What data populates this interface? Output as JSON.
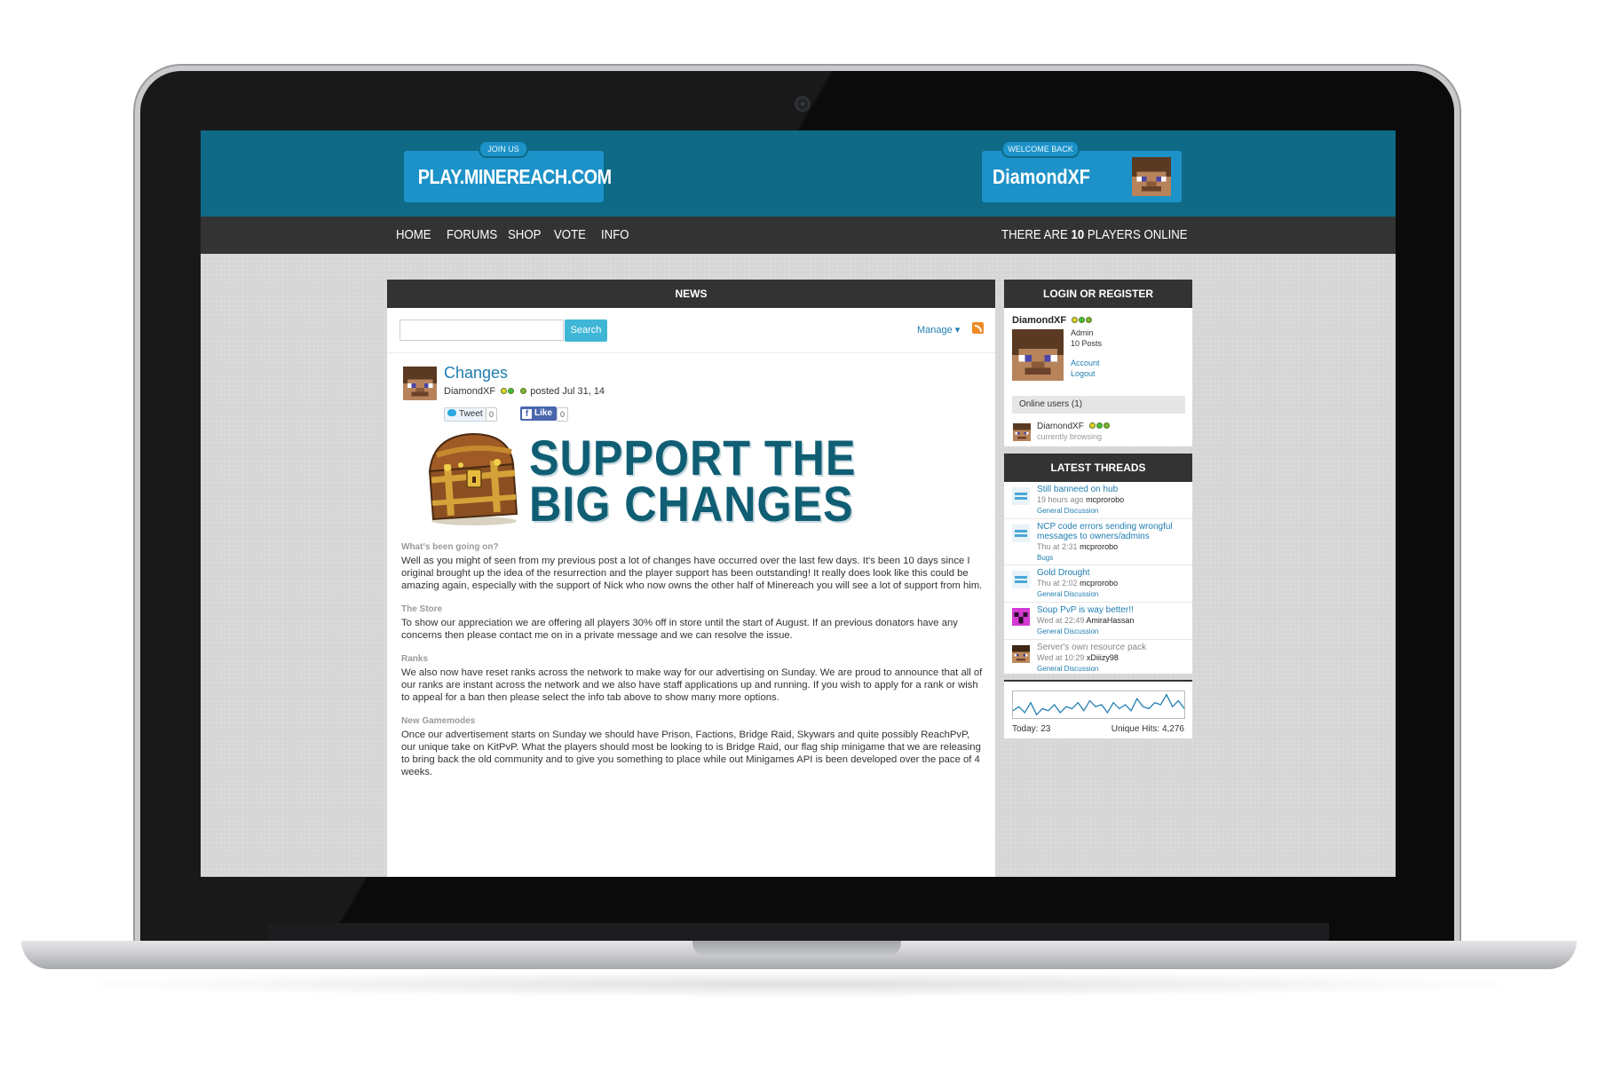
{
  "header": {
    "join_tag": "JOIN US",
    "server_address": "PLAY.MINEREACH.COM",
    "welcome_tag": "WELCOME BACK",
    "username": "DiamondXF"
  },
  "nav": {
    "items": [
      "HOME",
      "FORUMS",
      "SHOP",
      "VOTE",
      "INFO"
    ],
    "players_prefix": "THERE ARE",
    "players_count": "10",
    "players_suffix": "PLAYERS ONLINE"
  },
  "news": {
    "title": "NEWS",
    "search_placeholder": "",
    "search_button": "Search",
    "manage_label": "Manage ▾",
    "post": {
      "title": "Changes",
      "author": "DiamondXF",
      "posted": "posted Jul 31, 14",
      "tweet_label": "Tweet",
      "tweet_count": "0",
      "like_label": "Like",
      "like_count": "0",
      "banner_line1": "SUPPORT THE",
      "banner_line2": "BIG CHANGES",
      "sections": [
        {
          "heading": "What's been going on?",
          "body": "Well as you might of seen from my previous post a lot of changes have occurred over the last few days. It's been 10 days since I original brought up the idea of the resurrection and the player support has been outstanding! It really does look like this could be amazing again, especially with the support of Nick who now owns the other half of Minereach you will see a lot of support from him."
        },
        {
          "heading": "The Store",
          "body": "To show our appreciation we are offering all players 30% off in store until the start of August. If an previous donators have any concerns then please contact me on in a private message and we can resolve the issue."
        },
        {
          "heading": "Ranks",
          "body": "We also now have reset ranks across the network to make way for our advertising on Sunday. We are proud to announce that all of our ranks are instant across the network and we also have staff applications up and running. If you wish to apply for a rank or wish to appeal for a ban then please select the info tab above to show many more options."
        },
        {
          "heading": "New Gamemodes",
          "body": "Once our advertisement starts on Sunday we should have Prison, Factions, Bridge Raid, Skywars and quite possibly ReachPvP, our unique take on KitPvP. What the players should most be looking to is Bridge Raid, our flag ship minigame that we are releasing to bring back the old community and to give you something to place while out Minigames API is been developed over the pace of 4 weeks."
        }
      ]
    }
  },
  "sidebar": {
    "login_title": "LOGIN OR REGISTER",
    "user": {
      "name": "DiamondXF",
      "role": "Admin",
      "posts": "10 Posts",
      "account": "Account",
      "logout": "Logout"
    },
    "online_label": "Online users (1)",
    "online_user": {
      "name": "DiamondXF",
      "status": "currently browsing"
    },
    "threads_title": "LATEST THREADS",
    "threads": [
      {
        "title": "Still banneed on hub",
        "time": "19 hours ago",
        "user": "mcprorobo",
        "category": "General Discussion",
        "icon": "minereach-icon"
      },
      {
        "title": "NCP code errors sending wrongful messages to owners/admins",
        "time": "Thu at 2:31",
        "user": "mcprorobo",
        "category": "Bugs",
        "icon": "minereach-icon"
      },
      {
        "title": "Gold Drought",
        "time": "Thu at 2:02",
        "user": "mcprorobo",
        "category": "General Discussion",
        "icon": "minereach-icon"
      },
      {
        "title": "Soup PvP is way better!!",
        "time": "Wed at 22:49",
        "user": "AmiraHassan",
        "category": "General Discussion",
        "icon": "creeper-icon"
      },
      {
        "title": "Server's own resource pack",
        "time": "Wed at 10:29",
        "user": "xDiiizy98",
        "category": "General Discussion",
        "icon": "steve-icon"
      }
    ],
    "stats": {
      "today": "Today: 23",
      "unique": "Unique Hits: 4,276",
      "sparkline": [
        10,
        12,
        9,
        14,
        8,
        11,
        10,
        13,
        9,
        12,
        11,
        14,
        10,
        15,
        12,
        13,
        9,
        14,
        11,
        13,
        10,
        16,
        12,
        11,
        14,
        13,
        18,
        12,
        15,
        11
      ]
    }
  },
  "colors": {
    "header_bg": "#0e6a86",
    "brand_box": "#1c92c8",
    "nav_bg": "#333333",
    "link": "#1f7db0",
    "banner_text": "#0f5e74"
  }
}
